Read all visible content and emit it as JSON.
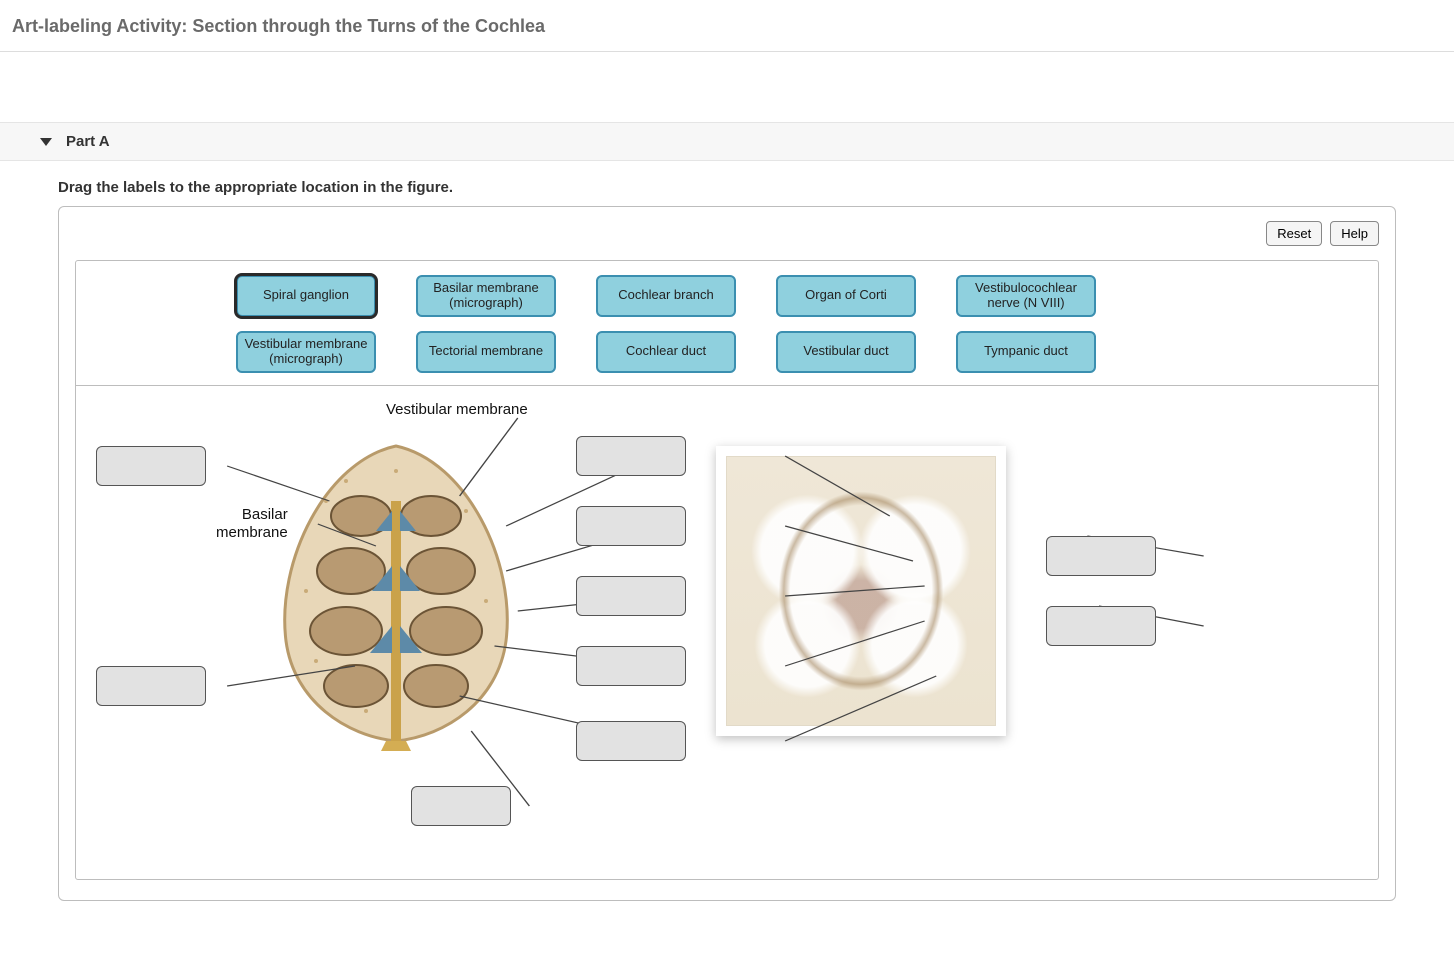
{
  "page_title": "Art-labeling Activity: Section through the Turns of the Cochlea",
  "part_title": "Part A",
  "instructions": "Drag the labels to the appropriate location in the figure.",
  "buttons": {
    "reset": "Reset",
    "help": "Help"
  },
  "labels_row1": [
    "Spiral ganglion",
    "Basilar membrane (micrograph)",
    "Cochlear branch",
    "Organ of Corti",
    "Vestibulocochlear nerve (N VIII)"
  ],
  "labels_row2": [
    "Vestibular membrane (micrograph)",
    "Tectorial membrane",
    "Cochlear duct",
    "Vestibular duct",
    "Tympanic duct"
  ],
  "fixed_labels": {
    "vestibular_membrane": "Vestibular membrane",
    "basilar_membrane": "Basilar\nmembrane"
  }
}
